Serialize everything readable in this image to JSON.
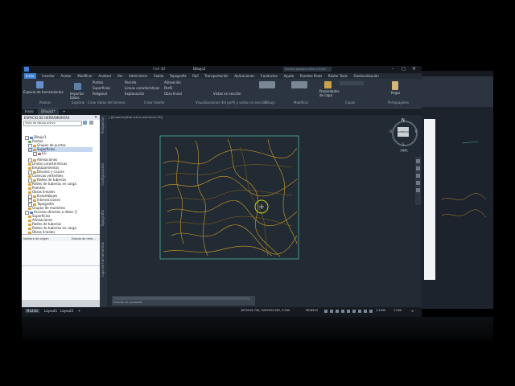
{
  "app": {
    "title_left": "Civil 3D",
    "title_center": "Dibujo1",
    "title_right": "Escriba palabra clave o frase"
  },
  "menus": [
    "Inicio",
    "Insertar",
    "Anotar",
    "Modificar",
    "Analizar",
    "Ver",
    "Administrar",
    "Salida",
    "Topografía",
    "Raíl",
    "Transportación",
    "Aplicaciones",
    "Conductos",
    "Ayuda",
    "Puentes Posts",
    "Ráster Tools",
    "Geolocalización"
  ],
  "ribbon": {
    "left_buttons": [
      "Espacio de herramientas",
      "Importar Datos"
    ],
    "col2": [
      "Puntos",
      "Superficies",
      "Polígonal"
    ],
    "col3": [
      "Parcela",
      "Líneas características",
      "Explanación"
    ],
    "col4": [
      "Alineación",
      "Perfil",
      "Obra lineal"
    ],
    "col5": [
      "Vistas en sección"
    ],
    "right_buttons": [
      "Propiedades de capa",
      "Pegar"
    ],
    "groups": [
      "Paletas",
      "Explorar",
      "Crear datos del terreno",
      "Crear diseño",
      "Visualizaciones del perfil y vistas en sección",
      "Dibujo",
      "Modificar",
      "Capas",
      "Portapapeles"
    ]
  },
  "tabs": {
    "inicio": "Inicio",
    "doc": "Dibujo1*",
    "add": "+"
  },
  "toolspace": {
    "title": "ESPACIO DE HERRAMIENTAS",
    "subtitle": "Vista de dibujo activo",
    "items": [
      "Dibujo1",
      "Puntos",
      "Grupos de puntos",
      "Superficies",
      "EG",
      "Alineaciones",
      "Líneas características",
      "Emplazamientos",
      "Desvíos y cruces",
      "Cuencas vertientes",
      "Redes de tuberías",
      "Redes de tuberías en carga",
      "Puentes",
      "Obras lineales",
      "Ensamblajes",
      "Intersecciones",
      "Topografía",
      "Grupos de muestreo",
      "Accesos directos a datos []",
      "Superficies",
      "Alineaciones",
      "Redes de tuberías",
      "Redes de tuberías en carga",
      "Obras lineales"
    ],
    "grid_col1": "Nombre de origen",
    "grid_col2": "Estado de refer..."
  },
  "side_labels": [
    "Prospector",
    "Configuración",
    "Topografía",
    "Caja de herramientas"
  ],
  "viewport": {
    "label": "[-][Superior][Estructura alámbrica 2D]",
    "viewcube_top": "N",
    "viewcube_face": "SUPERIOR",
    "viewcube_left": "O",
    "viewcube_right": "E",
    "viewcube_bottom": "S",
    "wcs": "SCU",
    "cmd_prompt": "Escriba un comando"
  },
  "status": {
    "tabs": [
      "Modelo",
      "Layout1",
      "Layout2"
    ],
    "coords": "2875516.726, 9209553.982, 0.000",
    "mode": "MODELO",
    "scale": "1:1000",
    "zoom": "1.000"
  },
  "colors": {
    "accent": "#3d7fd0",
    "contour": "#b8912c",
    "border": "#4fb3a0",
    "cursor": "#c6d21b"
  }
}
